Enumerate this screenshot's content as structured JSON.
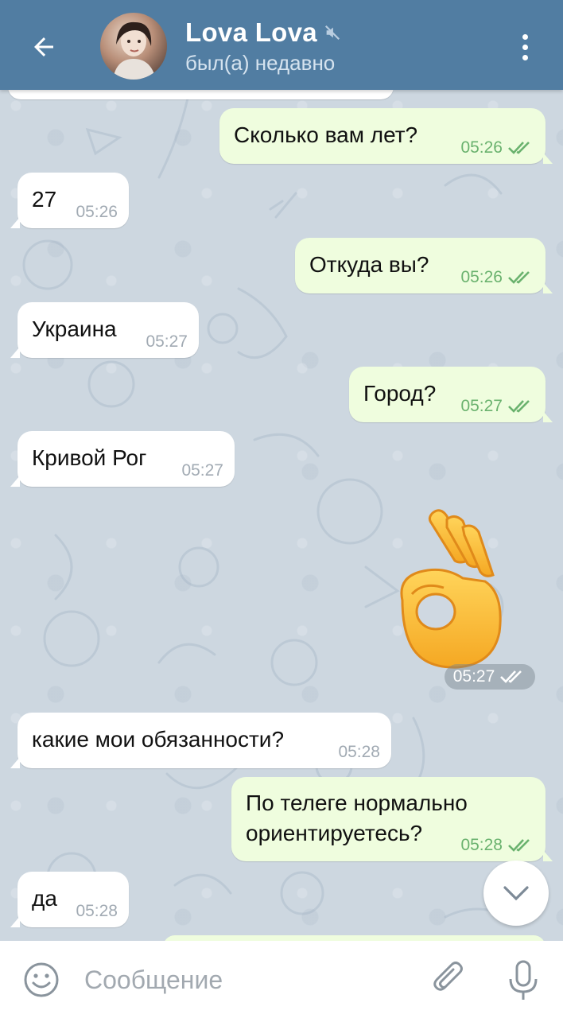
{
  "header": {
    "name": "Lova Lova",
    "status": "был(а) недавно",
    "muted": true
  },
  "messages": [
    {
      "dir": "out",
      "text": "Сколько вам лет?",
      "time": "05:26",
      "read": true
    },
    {
      "dir": "in",
      "text": "27",
      "time": "05:26"
    },
    {
      "dir": "out",
      "text": "Откуда вы?",
      "time": "05:26",
      "read": true
    },
    {
      "dir": "in",
      "text": "Украина",
      "time": "05:27"
    },
    {
      "dir": "out",
      "text": "Город?",
      "time": "05:27",
      "read": true
    },
    {
      "dir": "in",
      "text": "Кривой Рог",
      "time": "05:27"
    },
    {
      "dir": "out",
      "sticker": "ok-hand-emoji",
      "time": "05:27",
      "read": true
    },
    {
      "dir": "in",
      "text": "какие мои обязанности?",
      "time": "05:28"
    },
    {
      "dir": "out",
      "text": "По телеге нормально\nориентируетесь?",
      "time": "05:28",
      "read": true
    },
    {
      "dir": "in",
      "text": "да",
      "time": "05:28"
    }
  ],
  "input": {
    "placeholder": "Сообщение"
  },
  "colors": {
    "header_bg": "#517da2",
    "outgoing_bubble": "#effdde",
    "incoming_bubble": "#ffffff",
    "read_check": "#6ab26e",
    "chat_bg": "#cdd7e0"
  },
  "icons": [
    "back-arrow-icon",
    "mute-icon",
    "more-vertical-icon",
    "double-check-icon",
    "ok-hand-emoji",
    "chevron-down-icon",
    "emoji-icon",
    "attach-icon",
    "mic-icon"
  ]
}
